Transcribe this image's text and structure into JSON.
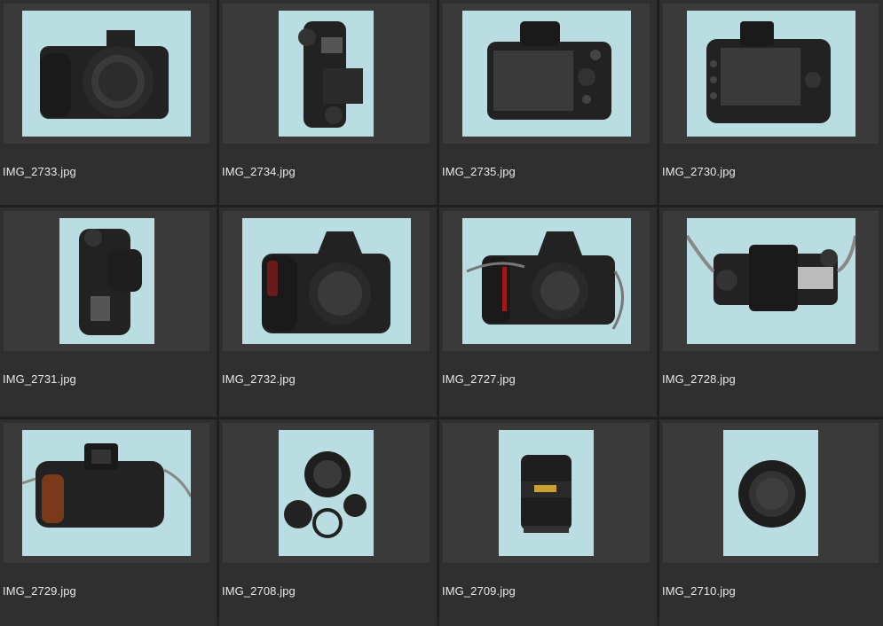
{
  "files": [
    {
      "name": "IMG_2733.jpg",
      "orientation": "land",
      "subject": "mirrorless-front"
    },
    {
      "name": "IMG_2734.jpg",
      "orientation": "port",
      "subject": "mirrorless-top"
    },
    {
      "name": "IMG_2735.jpg",
      "orientation": "land",
      "subject": "mirrorless-back"
    },
    {
      "name": "IMG_2730.jpg",
      "orientation": "land",
      "subject": "dslr-back"
    },
    {
      "name": "IMG_2731.jpg",
      "orientation": "port",
      "subject": "dslr-top"
    },
    {
      "name": "IMG_2732.jpg",
      "orientation": "land",
      "subject": "dslr-front"
    },
    {
      "name": "IMG_2727.jpg",
      "orientation": "land",
      "subject": "film-front"
    },
    {
      "name": "IMG_2728.jpg",
      "orientation": "land",
      "subject": "film-top"
    },
    {
      "name": "IMG_2729.jpg",
      "orientation": "land",
      "subject": "film-back"
    },
    {
      "name": "IMG_2708.jpg",
      "orientation": "port",
      "subject": "lens-caps"
    },
    {
      "name": "IMG_2709.jpg",
      "orientation": "port",
      "subject": "lens-side"
    },
    {
      "name": "IMG_2710.jpg",
      "orientation": "port",
      "subject": "lens-mount"
    }
  ],
  "colors": {
    "background": "#232323",
    "cell": "#2f2f2f",
    "photo_bg": "#b9dde0",
    "camera": "#1e1e1e"
  }
}
